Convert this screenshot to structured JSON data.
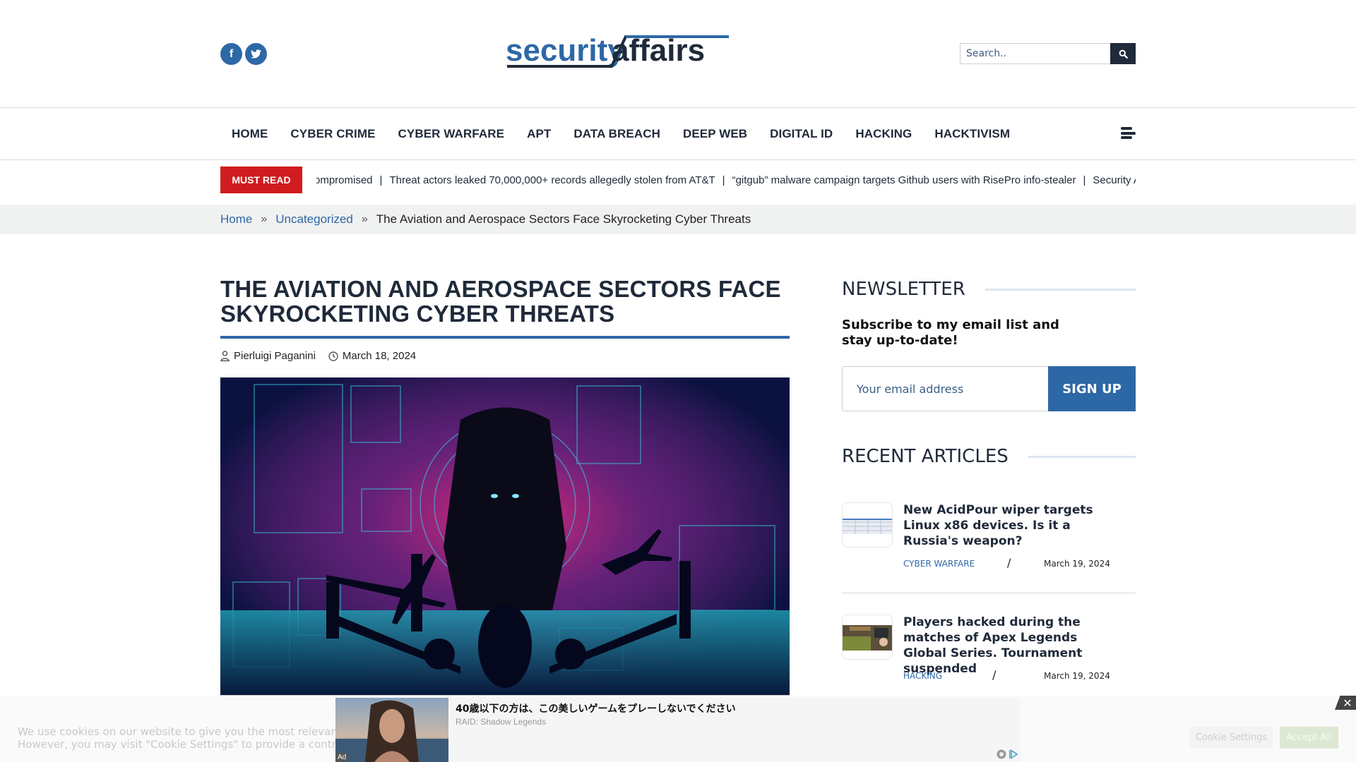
{
  "header": {
    "logo": {
      "part1": "security",
      "part2": "affairs"
    },
    "social": [
      {
        "name": "facebook",
        "glyph": "f"
      },
      {
        "name": "twitter",
        "glyph": "t"
      }
    ],
    "search": {
      "placeholder": "Search..",
      "value": ""
    }
  },
  "nav": {
    "items": [
      "HOME",
      "CYBER CRIME",
      "CYBER WARFARE",
      "APT",
      "DATA BREACH",
      "DEEP WEB",
      "DIGITAL ID",
      "HACKING",
      "HACKTIVISM"
    ]
  },
  "ticker": {
    "label": "MUST READ",
    "items": [
      "ompromised",
      "Threat actors leaked 70,000,000+ records allegedly stolen from AT&T",
      "“gitgub” malware campaign targets Github users with RisePro info-stealer",
      "Security Affa"
    ]
  },
  "breadcrumb": {
    "home": "Home",
    "category": "Uncategorized",
    "current": "The Aviation and Aerospace Sectors Face Skyrocketing Cyber Threats"
  },
  "article": {
    "title": "THE AVIATION AND AEROSPACE SECTORS FACE SKYROCKETING CYBER THREATS",
    "author": "Pierluigi Paganini",
    "date": "March 18, 2024"
  },
  "sidebar": {
    "newsletter": {
      "heading": "NEWSLETTER",
      "text": "Subscribe to my email list and stay up-to-date!",
      "email_placeholder": "Your email address",
      "button": "SIGN UP"
    },
    "recent": {
      "heading": "RECENT ARTICLES",
      "items": [
        {
          "title": "New AcidPour wiper targets Linux x86 devices. Is it a Russia's weapon?",
          "category": "CYBER WARFARE",
          "separator": "/",
          "date": "March 19, 2024"
        },
        {
          "title": "Players hacked during the matches of Apex Legends Global Series. Tournament suspended",
          "category": "HACKING",
          "separator": "/",
          "date": "March 19, 2024"
        }
      ]
    }
  },
  "cookie": {
    "text_line1": "We use cookies on our website to give you the most relevant expe",
    "text_line2": "However, you may visit \"Cookie Settings\" to provide a controlled co",
    "settings_button": "Cookie Settings",
    "accept_button": "Accept All",
    "close": "✕"
  },
  "ad": {
    "title": "40歳以下の方は、この美しいゲームをプレーしないでください",
    "brand": "RAID: Shadow Legends",
    "label": "Ad"
  },
  "colors": {
    "brand_blue": "#2d68a6",
    "dark_navy": "#1f2a3a",
    "must_read_red": "#d01c1f"
  }
}
